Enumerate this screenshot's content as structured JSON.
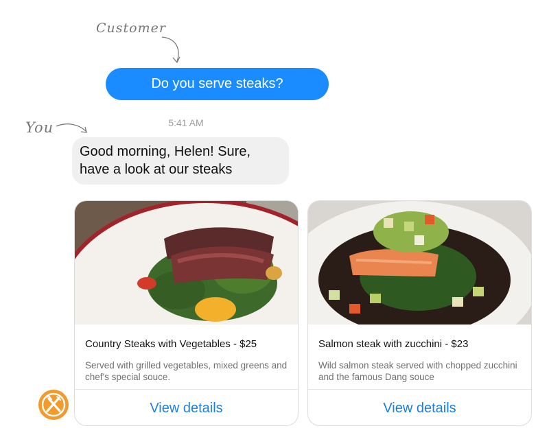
{
  "annotations": {
    "customer": "Customer",
    "you": "You"
  },
  "messages": {
    "outgoing_text": "Do you serve steaks?",
    "timestamp": "5:41 AM",
    "incoming_line1": "Good morning, Helen! Sure,",
    "incoming_line2": "have a look at our steaks"
  },
  "cards": [
    {
      "title": "Country Steaks with Vegetables - $25",
      "description": "Served with grilled vegetables,  mixed greens and chef's special souce.",
      "action": "View details",
      "image_icon": "steak-dish-photo"
    },
    {
      "title": "Salmon steak with zucchini - $23",
      "description": "Wild salmon steak served with chopped zucchini and the famous Dang souce",
      "action": "View details",
      "image_icon": "salmon-dish-photo"
    }
  ],
  "avatar_icon": "fork-knife-icon",
  "colors": {
    "outgoing_bubble": "#1a8cff",
    "incoming_bubble": "#f0f0f0",
    "link": "#1a7fe6",
    "avatar": "#f39a2b"
  }
}
